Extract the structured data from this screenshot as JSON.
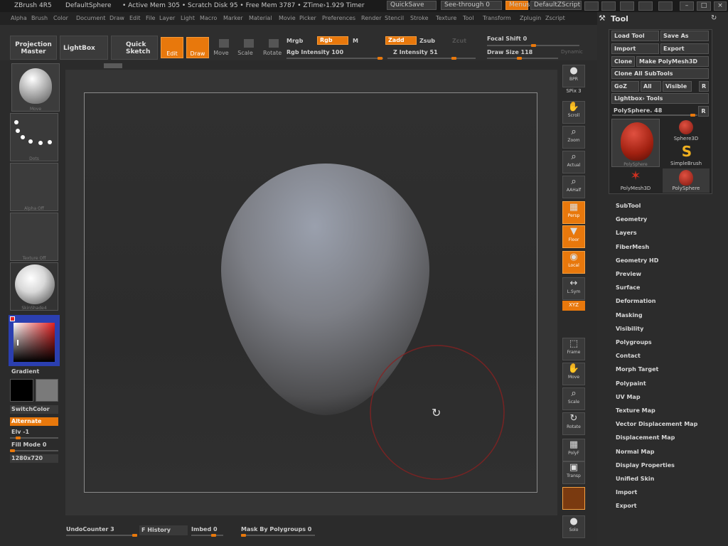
{
  "titlebar": {
    "app": "ZBrush 4R5",
    "doc": "DefaultSphere",
    "stats": "• Active Mem 305  • Scratch Disk 95  • Free Mem 3787  • ZTime›1.929  Timer",
    "quicksave": "QuickSave",
    "seethrough": "See-through  0",
    "menus": "Menus",
    "zscript": "DefaultZScript"
  },
  "menubar": [
    "Alpha",
    "Brush",
    "Color",
    "Document",
    "Draw",
    "Edit",
    "File",
    "Layer",
    "Light",
    "Macro",
    "Marker",
    "Material",
    "Movie",
    "Picker",
    "Preferences",
    "Render",
    "Stencil",
    "Stroke",
    "Texture",
    "Tool",
    "Transform",
    "Zplugin",
    "Zscript"
  ],
  "topbar": {
    "projection_master": "Projection Master",
    "lightbox": "LightBox",
    "quick_sketch": "Quick Sketch",
    "edit": "Edit",
    "draw": "Draw",
    "move": "Move",
    "scale": "Scale",
    "rotate": "Rotate",
    "mrgb": "Mrgb",
    "rgb": "Rgb",
    "m": "M",
    "rgb_intensity": "Rgb  Intensity 100",
    "zadd": "Zadd",
    "zsub": "Zsub",
    "zcut": "Zcut",
    "z_intensity": "Z Intensity 51",
    "focal_shift": "Focal Shift 0",
    "draw_size": "Draw Size 118",
    "dynamic": "Dynamic"
  },
  "leftpanel": {
    "brush_label": "Move",
    "stroke_label": "Dots",
    "alpha_label": "Alpha Off",
    "texture_label": "Texture Off",
    "material_label": "SkinShade4",
    "gradient": "Gradient",
    "switchcolor": "SwitchColor",
    "alternate": "Alternate",
    "elv": "Elv -1",
    "fill_mode": "Fill Mode 0",
    "resolution": "1280x720"
  },
  "righttoolbar": [
    {
      "name": "bpr-button",
      "label": "BPR",
      "icon": "●"
    },
    {
      "name": "spix",
      "label": "SPix 3",
      "icon": ""
    },
    {
      "name": "scroll-button",
      "label": "Scroll",
      "icon": "✋"
    },
    {
      "name": "zoom-button",
      "label": "Zoom",
      "icon": "⌕"
    },
    {
      "name": "actual-button",
      "label": "Actual",
      "icon": "⌕"
    },
    {
      "name": "aahalf-button",
      "label": "AAHalf",
      "icon": "⌕"
    },
    {
      "name": "persp-button",
      "label": "Persp",
      "icon": "▦"
    },
    {
      "name": "floor-button",
      "label": "Floor",
      "icon": "▼"
    },
    {
      "name": "local-button",
      "label": "Local",
      "icon": "◉"
    },
    {
      "name": "lsym-button",
      "label": "L.Sym",
      "icon": "↔"
    },
    {
      "name": "xyz-button",
      "label": "XYZ",
      "icon": ""
    },
    {
      "name": "frame-button",
      "label": "Frame",
      "icon": "⬚"
    },
    {
      "name": "move-view-button",
      "label": "Move",
      "icon": "✋"
    },
    {
      "name": "scale-view-button",
      "label": "Scale",
      "icon": "⌕"
    },
    {
      "name": "rotate-view-button",
      "label": "Rotate",
      "icon": "↻"
    },
    {
      "name": "polyf-button",
      "label": "PolyF",
      "icon": "▦"
    },
    {
      "name": "transp-button",
      "label": "Transp",
      "icon": "▣"
    },
    {
      "name": "ghost-button",
      "label": "",
      "icon": ""
    },
    {
      "name": "solo-button",
      "label": "Solo",
      "icon": "●"
    }
  ],
  "bottombar": {
    "undo": "UndoCounter 3",
    "history": "F History",
    "imbed": "Imbed 0",
    "mask": "Mask By Polygroups 0"
  },
  "toolpanel": {
    "title": "Tool",
    "buttons": [
      [
        "Load Tool",
        "Save As"
      ],
      [
        "Import",
        "Export"
      ],
      [
        "Clone",
        "Make PolyMesh3D"
      ],
      [
        "Clone All SubTools"
      ],
      [
        "GoZ",
        "All",
        "Visible",
        "R"
      ],
      [
        "Lightbox› Tools"
      ]
    ],
    "polysphere": "PolySphere. 48",
    "r": "R",
    "tools": [
      "PolySphere",
      "Sphere3D",
      "SimpleBrush",
      "PolyMesh3D",
      "PolySphere"
    ],
    "menu": [
      "SubTool",
      "Geometry",
      "Layers",
      "FiberMesh",
      "Geometry HD",
      "Preview",
      "Surface",
      "Deformation",
      "Masking",
      "Visibility",
      "Polygroups",
      "Contact",
      "Morph Target",
      "Polypaint",
      "UV Map",
      "Texture Map",
      "Vector Displacement Map",
      "Displacement Map",
      "Normal Map",
      "Display Properties",
      "Unified Skin",
      "Import",
      "Export"
    ]
  },
  "colors": {
    "accent": "#e8780c",
    "background": "#2b2b2b",
    "brush_circle": "#a02020"
  }
}
